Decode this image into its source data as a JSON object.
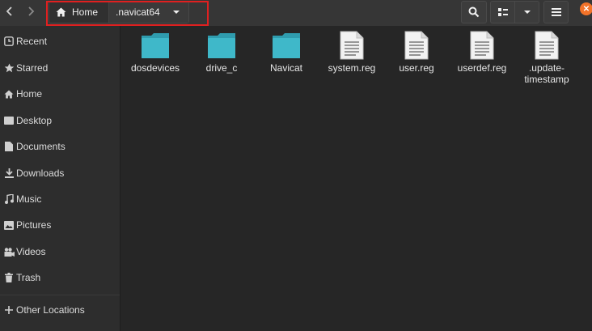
{
  "toolbar": {
    "back_icon": "chevron-left-icon",
    "forward_icon": "chevron-right-icon",
    "search_icon": "search-icon",
    "view_icon": "list-view-icon",
    "view_options_icon": "chevron-down-icon",
    "menu_icon": "hamburger-menu-icon",
    "close_icon": "close-icon"
  },
  "breadcrumb": {
    "home_label": "Home",
    "current_label": ".navicat64"
  },
  "sidebar": {
    "items": [
      {
        "label": "Recent",
        "icon": "clock-icon"
      },
      {
        "label": "Starred",
        "icon": "star-icon"
      },
      {
        "label": "Home",
        "icon": "home-icon"
      },
      {
        "label": "Desktop",
        "icon": "desktop-icon"
      },
      {
        "label": "Documents",
        "icon": "document-icon"
      },
      {
        "label": "Downloads",
        "icon": "download-icon"
      },
      {
        "label": "Music",
        "icon": "music-icon"
      },
      {
        "label": "Pictures",
        "icon": "picture-icon"
      },
      {
        "label": "Videos",
        "icon": "video-icon"
      },
      {
        "label": "Trash",
        "icon": "trash-icon"
      }
    ],
    "other_locations": {
      "label": "Other Locations",
      "icon": "plus-icon"
    }
  },
  "files": [
    {
      "name": "dosdevices",
      "type": "folder"
    },
    {
      "name": "drive_c",
      "type": "folder"
    },
    {
      "name": "Navicat",
      "type": "folder"
    },
    {
      "name": "system.reg",
      "type": "document"
    },
    {
      "name": "user.reg",
      "type": "document"
    },
    {
      "name": "userdef.reg",
      "type": "document"
    },
    {
      "name": ".update-timestamp",
      "type": "document"
    }
  ],
  "colors": {
    "folder": "#3fb8c9",
    "highlight": "#e02020",
    "close": "#f37329"
  }
}
